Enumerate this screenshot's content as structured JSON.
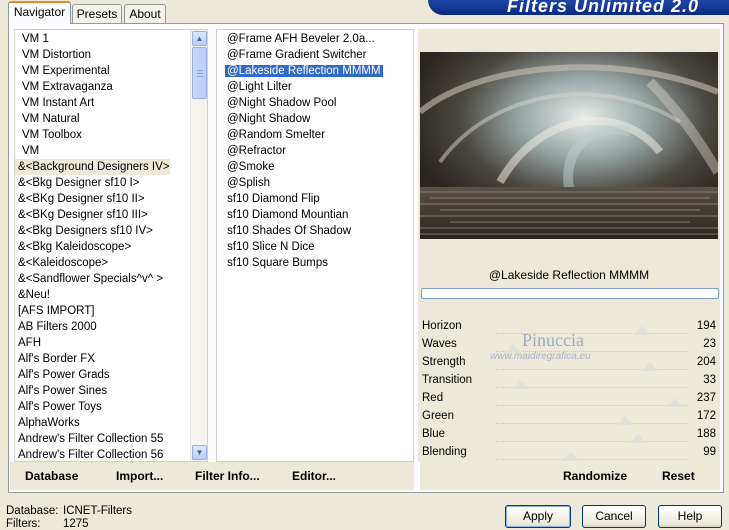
{
  "banner": {
    "title": "Filters Unlimited 2.0"
  },
  "tabs": [
    {
      "label": "Navigator"
    },
    {
      "label": "Presets"
    },
    {
      "label": "About"
    }
  ],
  "categories": [
    "VM 1",
    "VM Distortion",
    "VM Experimental",
    "VM Extravaganza",
    "VM Instant Art",
    "VM Natural",
    "VM Toolbox",
    "VM",
    "&<Background Designers IV>",
    "&<Bkg Designer sf10 I>",
    "&<BKg Designer sf10 II>",
    "&<BKg Designer sf10 III>",
    "&<Bkg Designers sf10 IV>",
    "&<Bkg Kaleidoscope>",
    "&<Kaleidoscope>",
    "&<Sandflower Specials^v^ >",
    "&Neu!",
    "[AFS IMPORT]",
    "AB Filters 2000",
    "AFH",
    "Alf's Border FX",
    "Alf's Power Grads",
    "Alf's Power Sines",
    "Alf's Power Toys",
    "AlphaWorks",
    "Andrew's Filter Collection 55",
    "Andrew's Filter Collection 56"
  ],
  "filters": [
    "@Frame AFH Beveler 2.0a...",
    "@Frame Gradient Switcher",
    "@Lakeside Reflection MMMM",
    "@Light Lilter",
    "@Night Shadow Pool",
    "@Night Shadow",
    "@Random Smelter",
    "@Refractor",
    "@Smoke",
    "@Splish",
    "sf10 Diamond Flip",
    "sf10 Diamond Mountian",
    "sf10 Shades Of Shadow",
    "sf10 Slice N Dice",
    "sf10 Square Bumps"
  ],
  "selected_filter": "@Lakeside Reflection MMMM",
  "left_buttons": {
    "database": "Database",
    "import": "Import...",
    "filter_info": "Filter Info...",
    "editor": "Editor..."
  },
  "right_buttons": {
    "randomize": "Randomize",
    "reset": "Reset"
  },
  "watermark": {
    "name": "Pinuccia",
    "url": "www.maidiregrafica.eu"
  },
  "params": [
    {
      "name": "Horizon",
      "value": "194",
      "level": 0.76
    },
    {
      "name": "Waves",
      "value": "23",
      "level": 0.09
    },
    {
      "name": "Strength",
      "value": "204",
      "level": 0.8
    },
    {
      "name": "Transition",
      "value": "33",
      "level": 0.13
    },
    {
      "name": "Red",
      "value": "237",
      "level": 0.93
    },
    {
      "name": "Green",
      "value": "172",
      "level": 0.67
    },
    {
      "name": "Blue",
      "value": "188",
      "level": 0.74
    },
    {
      "name": "Blending",
      "value": "99",
      "level": 0.39
    }
  ],
  "status": {
    "database_label": "Database:",
    "database_value": "ICNET-Filters",
    "filters_label": "Filters:",
    "filters_value": "1275"
  },
  "dialog_buttons": {
    "apply": "Apply",
    "cancel": "Cancel",
    "help": "Help"
  }
}
